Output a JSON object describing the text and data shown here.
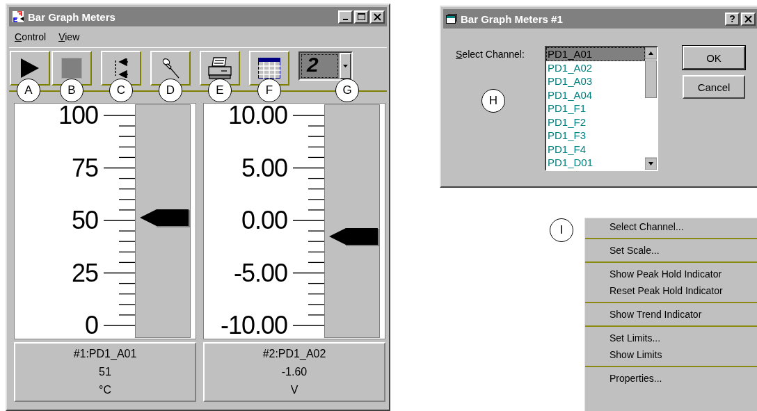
{
  "main_window": {
    "title": "Bar Graph Meters",
    "title_buttons": [
      {
        "kind": "minimize"
      },
      {
        "kind": "maximize"
      },
      {
        "kind": "close"
      }
    ],
    "menu": [
      {
        "label": "Control"
      },
      {
        "label": "View"
      }
    ],
    "toolbar": {
      "buttons": [
        {
          "kind": "play",
          "callout": "A"
        },
        {
          "kind": "stop",
          "callout": "B"
        },
        {
          "kind": "arrows",
          "callout": "C"
        },
        {
          "kind": "pin",
          "callout": "D"
        },
        {
          "kind": "print",
          "callout": "E"
        },
        {
          "kind": "table",
          "callout": "F"
        }
      ],
      "dropdown": {
        "value": "2",
        "callout": "G"
      }
    },
    "meters": [
      {
        "scale": [
          "100",
          "75",
          "50",
          "25",
          "0"
        ],
        "level": 0.51,
        "channel": "#1:PD1_A01",
        "reading": "51",
        "unit": "°C"
      },
      {
        "scale": [
          "10.00",
          "5.00",
          "0.00",
          "-5.00",
          "-10.00"
        ],
        "level": 0.42,
        "channel": "#2:PD1_A02",
        "reading": "-1.60",
        "unit": "V"
      }
    ]
  },
  "dialog": {
    "title": "Bar Graph Meters #1",
    "title_buttons": [
      {
        "kind": "help",
        "label": "?"
      },
      {
        "kind": "close"
      }
    ],
    "label": "Select Channel:",
    "channels": [
      {
        "name": "PD1_A01",
        "selected": true
      },
      {
        "name": "PD1_A02",
        "selected": false
      },
      {
        "name": "PD1_A03",
        "selected": false
      },
      {
        "name": "PD1_A04",
        "selected": false
      },
      {
        "name": "PD1_F1",
        "selected": false
      },
      {
        "name": "PD1_F2",
        "selected": false
      },
      {
        "name": "PD1_F3",
        "selected": false
      },
      {
        "name": "PD1_F4",
        "selected": false
      },
      {
        "name": "PD1_D01",
        "selected": false
      }
    ],
    "buttons": [
      {
        "label": "OK",
        "default": true
      },
      {
        "label": "Cancel",
        "default": false
      }
    ],
    "callout": "H"
  },
  "context_menu": {
    "callout": "I",
    "groups": [
      {
        "items": [
          "Select Channel..."
        ]
      },
      {
        "items": [
          "Set Scale..."
        ]
      },
      {
        "items": [
          "Show Peak Hold Indicator",
          "Reset Peak Hold Indicator"
        ]
      },
      {
        "items": [
          "Show Trend Indicator"
        ]
      },
      {
        "items": [
          "Set Limits...",
          "Show Limits"
        ]
      },
      {
        "items": [
          "Properties..."
        ]
      }
    ]
  }
}
